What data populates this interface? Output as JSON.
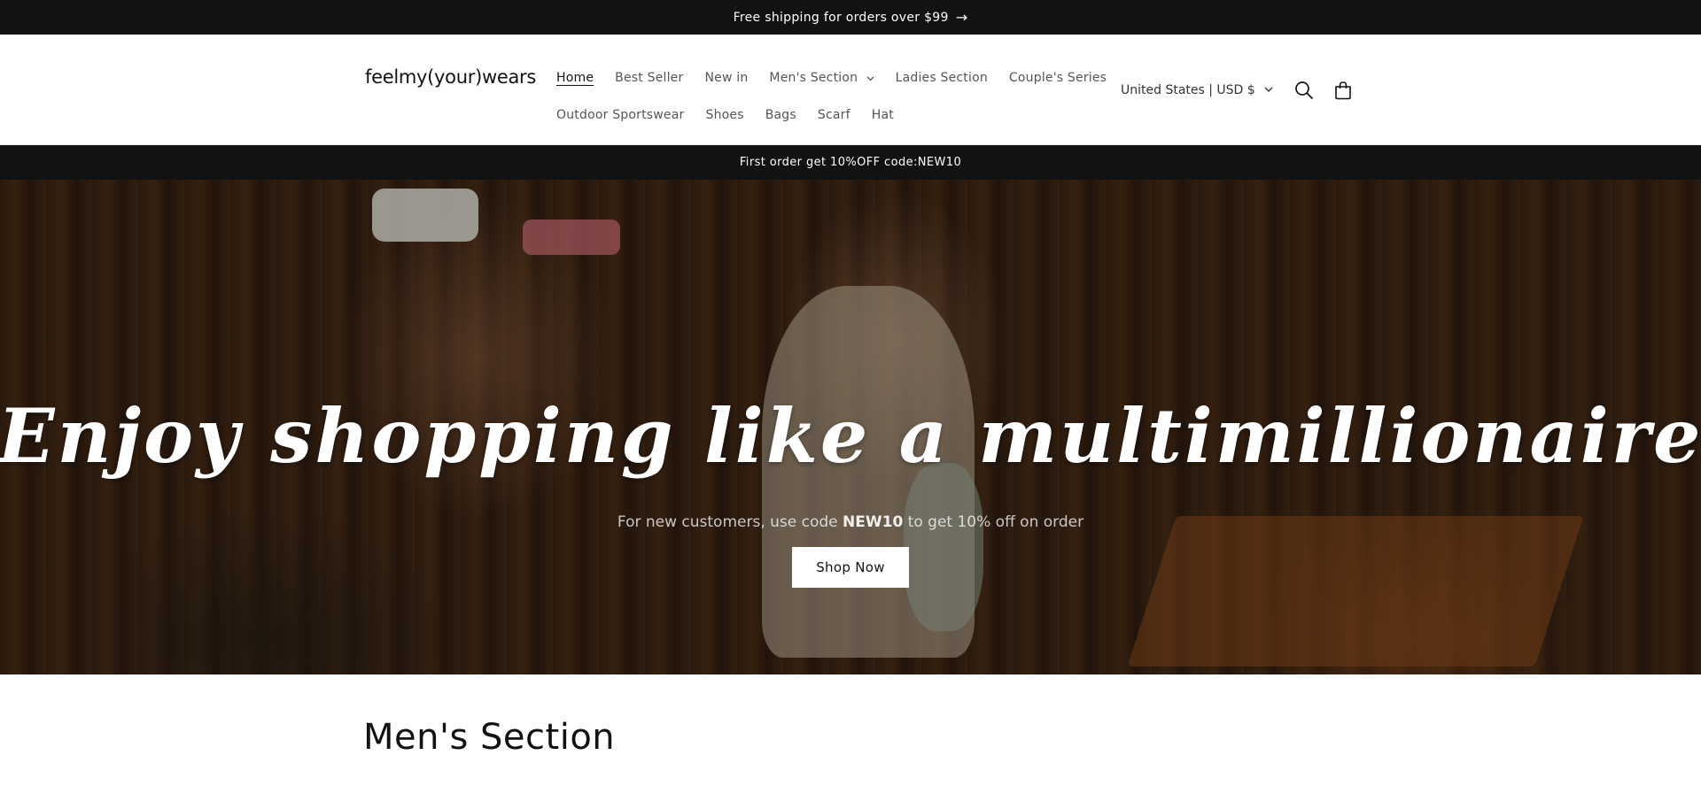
{
  "announcement": {
    "text": "Free shipping for orders over $99",
    "arrow": "→"
  },
  "header": {
    "logo": "feelmy(your)wears",
    "nav_row1": [
      {
        "label": "Home",
        "active": true
      },
      {
        "label": "Best Seller"
      },
      {
        "label": "New in"
      },
      {
        "label": "Men's Section",
        "has_dropdown": true
      },
      {
        "label": "Ladies Section"
      },
      {
        "label": "Couple's Series"
      }
    ],
    "nav_row2": [
      {
        "label": "Outdoor Sportswear"
      },
      {
        "label": "Shoes"
      },
      {
        "label": "Bags"
      },
      {
        "label": "Scarf"
      },
      {
        "label": "Hat"
      }
    ],
    "country": "United States | USD $",
    "icons": [
      "search-icon",
      "cart-icon",
      "chevron-down-icon"
    ]
  },
  "promo": {
    "text": "First order get 10%OFF code:NEW10"
  },
  "hero": {
    "title": "Enjoy shopping like a multimillionaire",
    "subtitle_before": "For new customers, use code ",
    "subtitle_code": "NEW10",
    "subtitle_after": " to get 10% off on order",
    "button": "Shop Now"
  },
  "section": {
    "title": "Men's Section"
  },
  "colors": {
    "dark": "#121212",
    "white": "#ffffff"
  }
}
